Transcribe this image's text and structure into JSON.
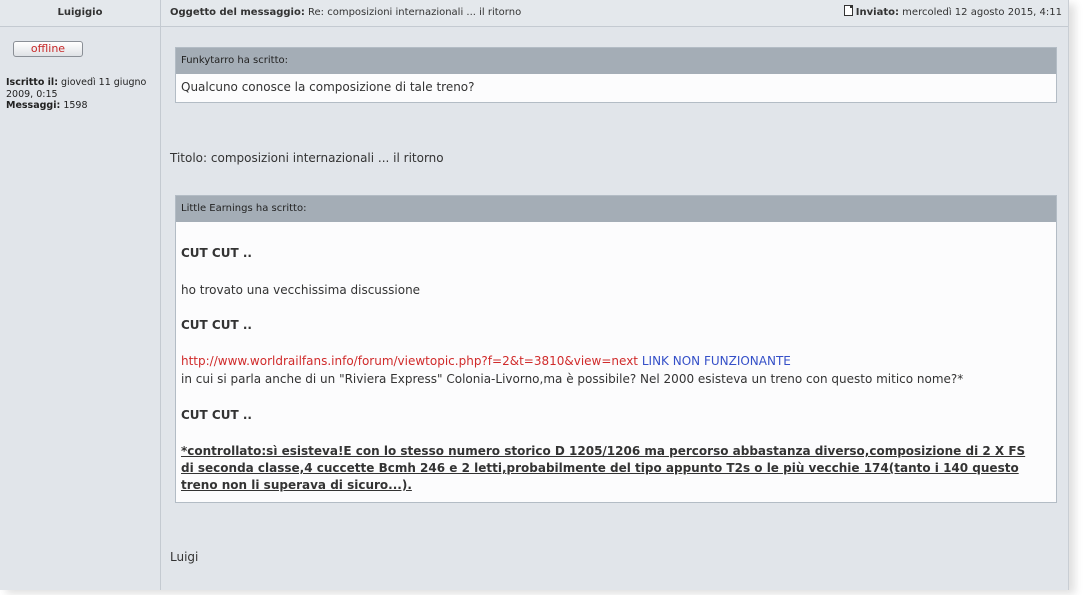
{
  "header": {
    "author": "Luigigio",
    "subject_label": "Oggetto del messaggio:",
    "subject_value": "Re: composizioni internazionali ... il ritorno",
    "posted_label": "Inviato:",
    "posted_value": "mercoledì 12 agosto 2015, 4:11"
  },
  "user": {
    "status": "offline",
    "joined_label": "Iscritto il:",
    "joined_value": "giovedì 11 giugno 2009, 0:15",
    "posts_label": "Messaggi:",
    "posts_value": "1598"
  },
  "quote1": {
    "header": "Funkytarro ha scritto:",
    "text": "Qualcuno conosce la composizione di tale treno?"
  },
  "title_line": "Titolo: composizioni internazionali ... il ritorno",
  "quote2": {
    "header": "Little Earnings ha scritto:",
    "cut1": "CUT CUT ..",
    "found": "ho trovato una vecchissima discussione",
    "cut2": "CUT CUT ..",
    "link": "http://www.worldrailfans.info/forum/viewtopic.php?f=2&t=3810&view=next",
    "link_note": "LINK NON FUNZIONANTE",
    "riviera": "in cui si parla anche di un \"Riviera Express\" Colonia-Livorno,ma è possibile? Nel 2000 esisteva un treno con questo mitico nome?*",
    "cut3": "CUT CUT ..",
    "checked": "*controllato:sì esisteva!E con lo stesso numero storico D 1205/1206 ma percorso abbastanza diverso,composizione di 2 X FS di seconda classe,4 cuccette Bcmh 246 e 2 letti,probabilmente del tipo appunto T2s o le più vecchie 174(tanto i 140 questo treno non li superava di sicuro...)."
  },
  "signature": "Luigi"
}
